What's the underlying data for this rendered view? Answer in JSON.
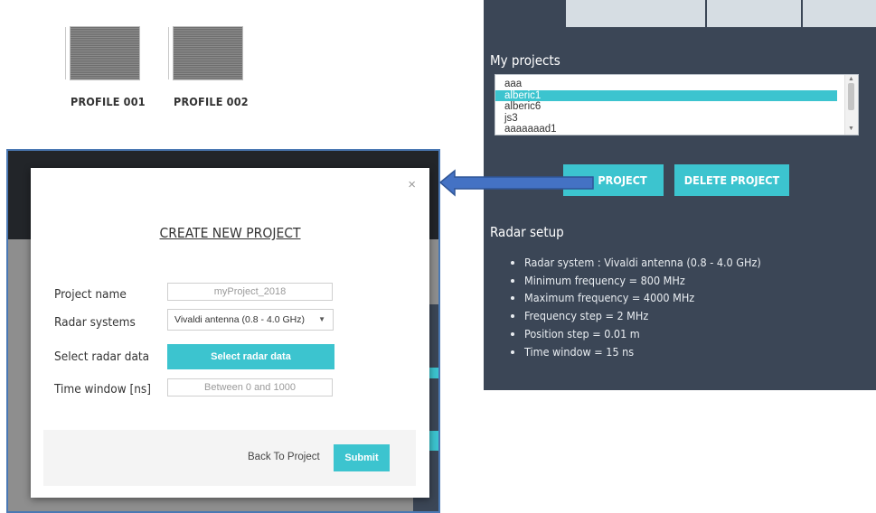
{
  "profiles": [
    {
      "label": "PROFILE 001"
    },
    {
      "label": "PROFILE 002"
    }
  ],
  "right_panel": {
    "projects_title": "My projects",
    "projects": [
      "aaa",
      "alberic1",
      "alberic6",
      "js3",
      "aaaaaaad1"
    ],
    "selected_project": "alberic1",
    "project_button_label": "PROJECT",
    "delete_button_label": "DELETE PROJECT",
    "setup_title": "Radar setup",
    "setup_items": [
      "Radar system : Vivaldi antenna (0.8 - 4.0 GHz)",
      "Minimum frequency = 800 MHz",
      "Maximum frequency = 4000 MHz",
      "Frequency step = 2 MHz",
      "Position step = 0.01 m",
      "Time window = 15 ns"
    ]
  },
  "modal": {
    "title": "CREATE NEW PROJECT",
    "close_glyph": "×",
    "project_name_label": "Project name",
    "project_name_value": "myProject_2018",
    "radar_systems_label": "Radar systems",
    "radar_systems_selected": "Vivaldi antenna (0.8 - 4.0 GHz)",
    "select_data_label": "Select radar data",
    "select_data_button": "Select radar data",
    "time_window_label": "Time window [ns]",
    "time_window_placeholder": "Between 0 and 1000",
    "back_link": "Back To Project",
    "submit_label": "Submit"
  },
  "colors": {
    "accent": "#3cc4cf",
    "panel": "#3b4656",
    "frame_border": "#4a78b3",
    "active_tab_text": "#e64b3c"
  }
}
